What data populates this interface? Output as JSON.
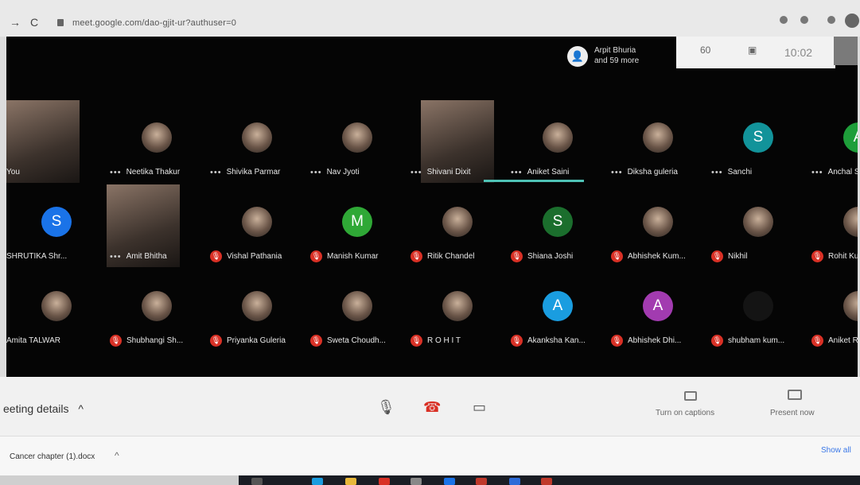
{
  "browser": {
    "url": "meet.google.com/dao-gjit-ur?authuser=0",
    "back_glyph": "→",
    "reload_glyph": "C"
  },
  "meeting": {
    "participants_line1": "Arpit Bhuria",
    "participants_line2": "and 59 more",
    "participants_badge": "60",
    "clock": "10:02",
    "chat_glyph": "▣",
    "people_glyph": "👤"
  },
  "tiles": [
    {
      "name": "You",
      "kind": "video",
      "status": "none"
    },
    {
      "name": "Neetika Thakur",
      "kind": "photo",
      "status": "dots"
    },
    {
      "name": "Shivika Parmar",
      "kind": "photo",
      "status": "dots"
    },
    {
      "name": "Nav Jyoti",
      "kind": "photo",
      "status": "dots"
    },
    {
      "name": "Shivani Dixit",
      "kind": "video",
      "status": "dots"
    },
    {
      "name": "Aniket Saini",
      "kind": "photo",
      "status": "dots"
    },
    {
      "name": "Diksha guleria",
      "kind": "photo",
      "status": "dots"
    },
    {
      "name": "Sanchi",
      "kind": "letter",
      "letter": "S",
      "color": "#12939a",
      "status": "dots"
    },
    {
      "name": "Anchal Sh",
      "kind": "letter",
      "letter": "A",
      "color": "#1e9e3a",
      "status": "dots"
    },
    {
      "name": "SHRUTIKA Shr...",
      "kind": "letter",
      "letter": "S",
      "color": "#1a73e8",
      "status": "none"
    },
    {
      "name": "Amit Bhitha",
      "kind": "video",
      "status": "dots"
    },
    {
      "name": "Vishal Pathania",
      "kind": "photo",
      "status": "muted"
    },
    {
      "name": "Manish Kumar",
      "kind": "letter",
      "letter": "M",
      "color": "#2fa836",
      "status": "muted"
    },
    {
      "name": "Ritik Chandel",
      "kind": "photo",
      "status": "muted"
    },
    {
      "name": "Shiana Joshi",
      "kind": "letter",
      "letter": "S",
      "color": "#1b6e2d",
      "status": "muted"
    },
    {
      "name": "Abhishek Kum...",
      "kind": "photo",
      "status": "muted"
    },
    {
      "name": "Nikhil",
      "kind": "photo",
      "status": "muted"
    },
    {
      "name": "Rohit Kum",
      "kind": "photo",
      "status": "muted"
    },
    {
      "name": "Amita TALWAR",
      "kind": "photo",
      "status": "none"
    },
    {
      "name": "Shubhangi Sh...",
      "kind": "photo",
      "status": "muted"
    },
    {
      "name": "Priyanka Guleria",
      "kind": "photo",
      "status": "muted"
    },
    {
      "name": "Sweta Choudh...",
      "kind": "photo",
      "status": "muted"
    },
    {
      "name": "R O H I T",
      "kind": "photo",
      "status": "muted"
    },
    {
      "name": "Akanksha Kan...",
      "kind": "letter",
      "letter": "A",
      "color": "#1a9de0",
      "status": "muted"
    },
    {
      "name": "Abhishek Dhi...",
      "kind": "letter",
      "letter": "A",
      "color": "#a23bb0",
      "status": "muted"
    },
    {
      "name": "shubham kum...",
      "kind": "blank",
      "status": "muted"
    },
    {
      "name": "Aniket Ran",
      "kind": "photo",
      "status": "muted"
    }
  ],
  "controls": {
    "meeting_details": "eeting details",
    "details_caret": "^",
    "mic_glyph": "🎙",
    "hangup_glyph": "☎",
    "camera_glyph": "▭",
    "captions_label": "Turn on captions",
    "present_label": "Present now"
  },
  "downloads": {
    "file_name": "Cancer chapter (1).docx",
    "caret": "^",
    "show_all": "Show all"
  },
  "glyphs": {
    "dots": "•••",
    "mute": "🎙"
  }
}
